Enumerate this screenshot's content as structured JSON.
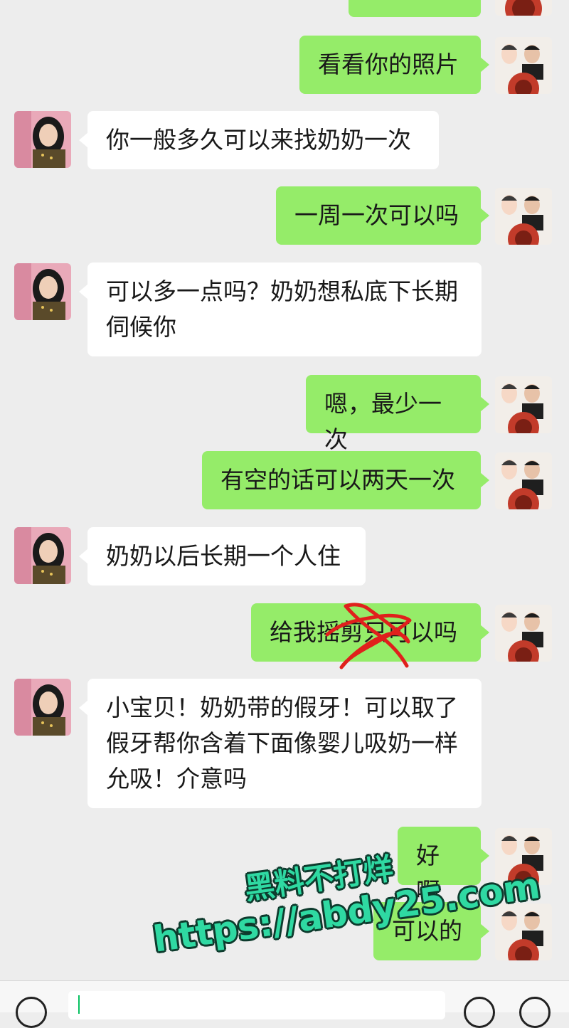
{
  "chat": {
    "messages": [
      {
        "sender": "self",
        "text": ""
      },
      {
        "sender": "self",
        "text": "看看你的照片"
      },
      {
        "sender": "other",
        "text": "你一般多久可以来找奶奶一次"
      },
      {
        "sender": "self",
        "text": "一周一次可以吗"
      },
      {
        "sender": "other",
        "text": "可以多一点吗？奶奶想私底下长期伺候你"
      },
      {
        "sender": "self",
        "text": "嗯，最少一次"
      },
      {
        "sender": "self",
        "text": "有空的话可以两天一次"
      },
      {
        "sender": "other",
        "text": "奶奶以后长期一个人住"
      },
      {
        "sender": "self",
        "text": "给我摇剪只可以吗"
      },
      {
        "sender": "other",
        "text": "小宝贝！奶奶带的假牙！可以取了假牙帮你含着下面像婴儿吸奶一样允吸！介意吗"
      },
      {
        "sender": "self",
        "text": "好啊"
      },
      {
        "sender": "self",
        "text": "可以的"
      }
    ]
  },
  "watermark": {
    "line1": "黑料不打烊",
    "line2": "https://abdy25.com"
  },
  "colors": {
    "background": "#ededed",
    "self_bubble": "#95ec69",
    "other_bubble": "#ffffff",
    "watermark_fill": "#2fd9a2",
    "scribble": "#e0201c"
  },
  "icons": {
    "voice": "voice-icon",
    "emoji": "emoji-icon",
    "add": "plus-circle-icon"
  }
}
